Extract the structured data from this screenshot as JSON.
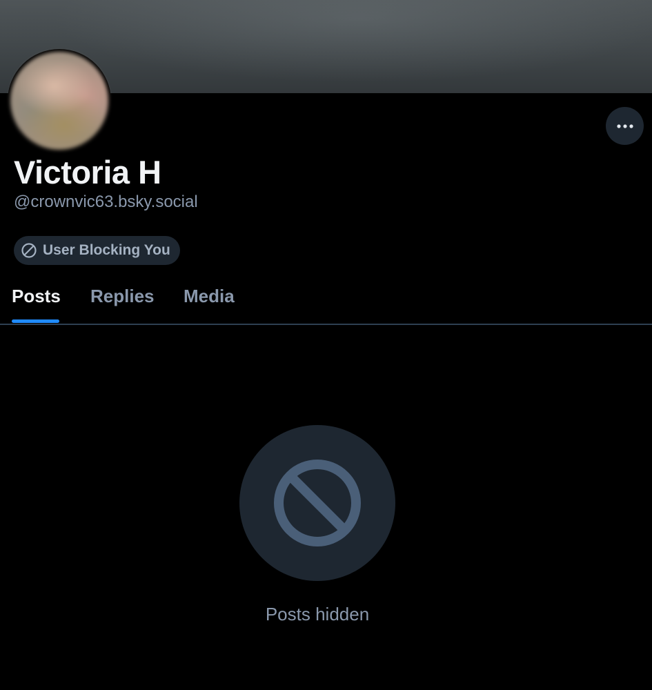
{
  "profile": {
    "display_name": "Victoria H",
    "handle": "@crownvic63.bsky.social",
    "block_badge": {
      "label": "User Blocking You",
      "icon": "block-icon"
    },
    "more_button_icon": "ellipsis-icon"
  },
  "tabs": [
    {
      "label": "Posts",
      "active": true
    },
    {
      "label": "Replies",
      "active": false
    },
    {
      "label": "Media",
      "active": false
    }
  ],
  "empty_state": {
    "icon": "block-icon",
    "message": "Posts hidden"
  },
  "colors": {
    "background": "#000000",
    "surface": "#1e2731",
    "text_primary": "#f1f3f5",
    "text_secondary": "#8a98ac",
    "accent": "#208bfe",
    "icon_muted": "#4a5f78"
  }
}
